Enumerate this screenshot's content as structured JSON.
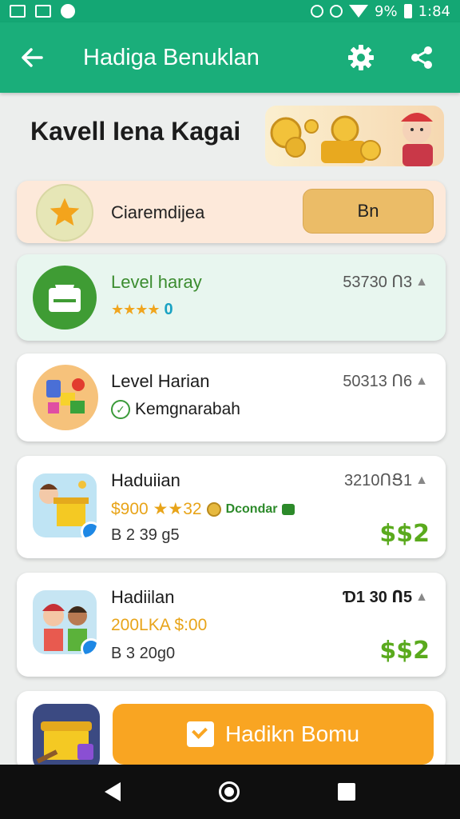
{
  "status_bar": {
    "battery": "9%",
    "time": "1:84"
  },
  "app_bar": {
    "title": "Hadiga Benuklan"
  },
  "header": {
    "headline": "Kavell Iena Kagai"
  },
  "promo": {
    "label": "Ciaremdijea",
    "button": "Bn"
  },
  "items": [
    {
      "title": "Level haray",
      "meta": "53730 Ո3",
      "stars": "★★★★",
      "value": "0"
    },
    {
      "title": "Level Harian",
      "meta": "50313 Ո6",
      "status": "Kemgnarabah"
    },
    {
      "title": "Haduiian",
      "meta": "3210ՈՑ1",
      "amount": "$900 ★★32",
      "link": "Dcondar",
      "line": "B 2 39 g5",
      "price": "$$2"
    },
    {
      "title": "Hadiilan",
      "meta": "Ɗ1 30 Ո5",
      "amount": "200LKA $:00",
      "line": "B 3 20g0",
      "price": "$$2"
    }
  ],
  "cta": {
    "label": "Hadikn Bomu"
  },
  "icons": {
    "back": "arrow-left-icon",
    "settings": "gear-icon",
    "share": "share-icon",
    "star": "star-icon",
    "check": "check-circle-icon",
    "mail": "mail-icon"
  },
  "colors": {
    "primary": "#1aae7a",
    "accent": "#f9a522",
    "price": "#5aaa1d"
  }
}
